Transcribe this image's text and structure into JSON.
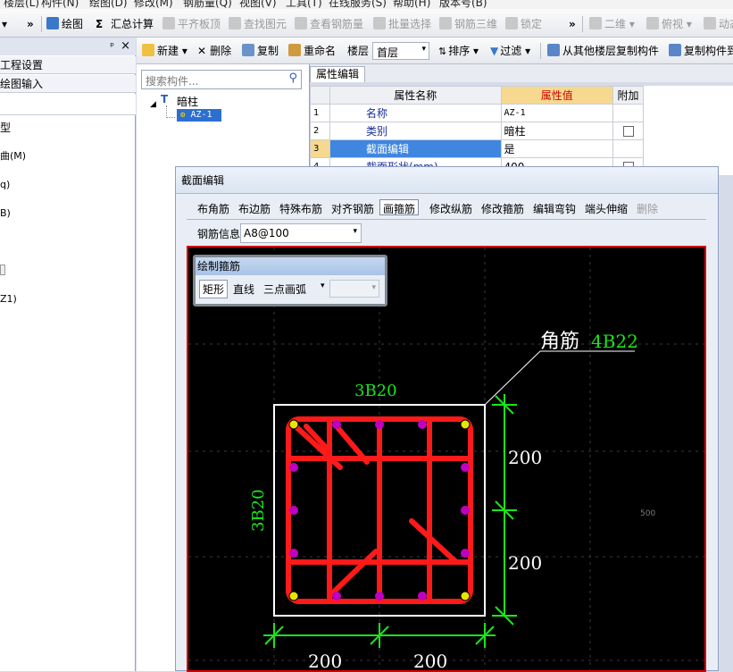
{
  "menubar": {
    "items": [
      "楼层(L)",
      "构件(N)",
      "绘图(D)",
      "修改(M)",
      "钢筋量(Q)",
      "视图(V)",
      "工具(T)",
      "在线服务(S)",
      "帮助(H)",
      "版本号(B)"
    ]
  },
  "toolbar1": {
    "overflow": "»",
    "draw": "绘图",
    "calc_sigma": "Σ",
    "calc": "汇总计算",
    "flat_slab": "平齐板顶",
    "find_element": "查找图元",
    "view_rebar": "查看钢筋量",
    "batch_select": "批量选择",
    "rebar_3d": "钢筋三维",
    "lock": "锁定",
    "view_2d": "二维",
    "top_view": "俯视",
    "dynamic": "动态",
    "overflow2": "»"
  },
  "leftpanel": {
    "pin": "ᵖ",
    "close": "×",
    "project_settings": "工程设置",
    "drawing_input": "绘图输入",
    "type_fragment": "型",
    "m_fragment": "曲(M)",
    "q_fragment": "q)",
    "b_fragment": "B)",
    "z_fragment": "Z1)"
  },
  "toolbar2": {
    "new": "新建",
    "delete": "删除",
    "copy": "复制",
    "rename": "重命名",
    "floor_label": "楼层",
    "floor_value": "首层",
    "sort": "排序",
    "filter": "过滤",
    "copy_from_floor": "从其他楼层复制构件",
    "copy_to": "复制构件到"
  },
  "search": {
    "placeholder": "搜索构件..."
  },
  "tree": {
    "root": "暗柱",
    "child": "AZ-1"
  },
  "properties": {
    "tab": "属性编辑",
    "headers": {
      "name": "属性名称",
      "value": "属性值",
      "extra": "附加"
    },
    "rows": [
      {
        "num": "1",
        "name": "名称",
        "value": "AZ-1",
        "checkbox": false
      },
      {
        "num": "2",
        "name": "类别",
        "value": "暗柱",
        "checkbox": true
      },
      {
        "num": "3",
        "name": "截面编辑",
        "value": "是",
        "checkbox": false
      },
      {
        "num": "4",
        "name": "截面形状(mm)",
        "value": "400",
        "checkbox": true
      }
    ]
  },
  "dialog": {
    "title": "截面编辑",
    "tabs": [
      "布角筋",
      "布边筋",
      "特殊布筋",
      "对齐钢筋",
      "画箍筋",
      "修改纵筋",
      "修改箍筋",
      "编辑弯钩",
      "端头伸缩",
      "删除"
    ],
    "rebar_info_label": "钢筋信息",
    "rebar_info_value": "A8@100",
    "draw_panel_title": "绘制箍筋",
    "draw_rect": "矩形",
    "draw_line": "直线",
    "draw_arc": "三点画弧"
  },
  "canvas": {
    "corner_label": "角筋",
    "corner_value": "4B22",
    "top_label": "3B20",
    "side_label": "3B20",
    "dim_right_top": "200",
    "dim_right_bottom": "200",
    "dim_bottom_left": "200",
    "dim_bottom_right": "200",
    "axis_tick": "500"
  },
  "colors": {
    "rebar_red": "#ff1a1a",
    "dim_green": "#19e619",
    "label_green": "#19e619",
    "bar_magenta": "#c000c0",
    "bar_yellow": "#e6e600"
  }
}
